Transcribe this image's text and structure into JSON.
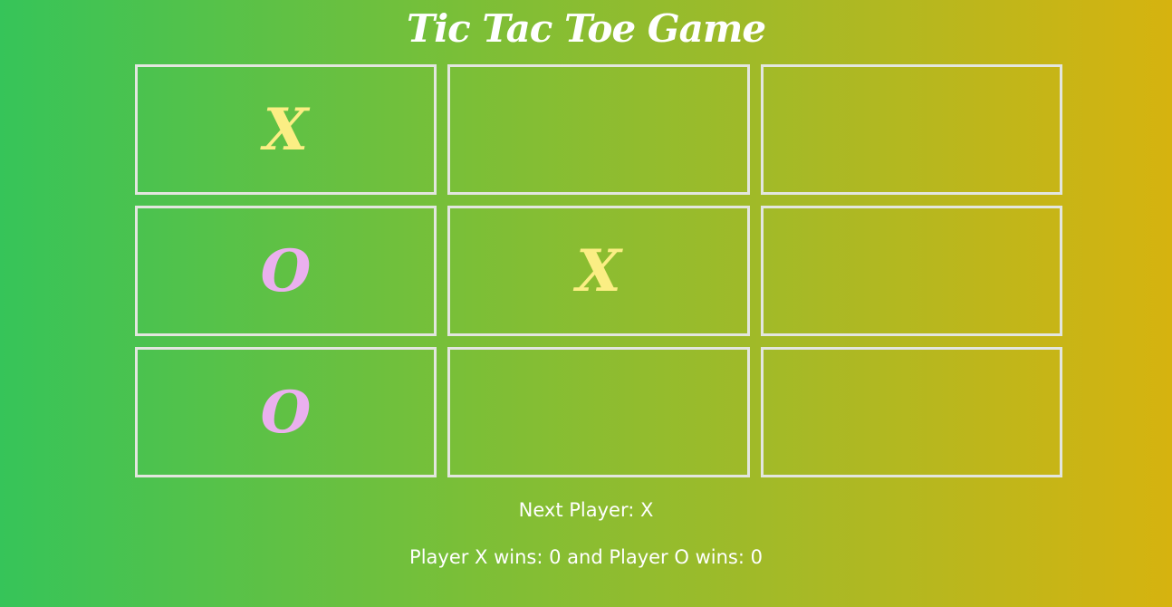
{
  "title": "Tic Tac Toe Game",
  "board": {
    "cells": [
      "X",
      "",
      "",
      "O",
      "X",
      "",
      "O",
      "",
      ""
    ]
  },
  "status": {
    "next_player": "Next Player: X",
    "score": "Player X wins: 0 and Player O wins: 0"
  },
  "colors": {
    "x_mark": "#fbee84",
    "o_mark": "#eab0ee",
    "cell_border": "#e3e6df",
    "gradient_start": "#36c459",
    "gradient_end": "#d6b30f"
  }
}
